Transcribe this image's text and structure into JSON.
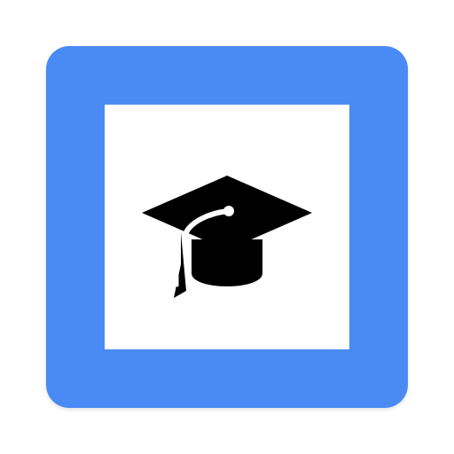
{
  "icon": {
    "name": "graduation-cap-icon",
    "frame_color": "#4a8af4",
    "inner_color": "#ffffff",
    "glyph_color": "#000000"
  }
}
